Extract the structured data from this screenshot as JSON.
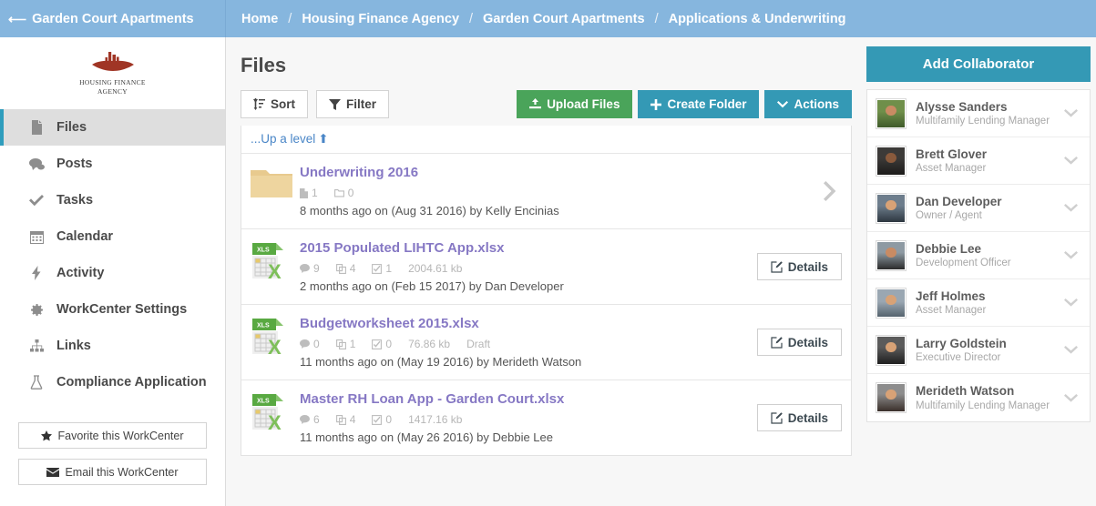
{
  "topbar": {
    "workcenter_name": "Garden Court Apartments",
    "back_icon": "arrow-left-icon",
    "breadcrumb": [
      "Home",
      "Housing Finance Agency",
      "Garden Court Apartments",
      "Applications & Underwriting"
    ],
    "breadcrumb_separator": "/",
    "bg_color": "#86b6de"
  },
  "sidebar": {
    "logo_line1": "HOUSING FINANCE",
    "logo_line2": "AGENCY",
    "logo_color": "#a03525",
    "items": [
      {
        "label": "Files",
        "icon": "file-icon",
        "active": true
      },
      {
        "label": "Posts",
        "icon": "comments-icon",
        "active": false
      },
      {
        "label": "Tasks",
        "icon": "check-icon",
        "active": false
      },
      {
        "label": "Calendar",
        "icon": "calendar-icon",
        "active": false
      },
      {
        "label": "Activity",
        "icon": "bolt-icon",
        "active": false
      },
      {
        "label": "WorkCenter Settings",
        "icon": "gear-icon",
        "active": false
      },
      {
        "label": "Links",
        "icon": "sitemap-icon",
        "active": false
      },
      {
        "label": "Compliance Application",
        "icon": "flask-icon",
        "active": false
      }
    ],
    "favorite_button": "Favorite this WorkCenter",
    "favorite_icon": "star-icon",
    "email_button": "Email this WorkCenter",
    "email_icon": "envelope-icon",
    "active_accent": "#2f9dbd"
  },
  "main": {
    "page_title": "Files",
    "toolbar": {
      "sort_label": "Sort",
      "sort_icon": "sort-amount-icon",
      "filter_label": "Filter",
      "filter_icon": "funnel-icon",
      "upload_label": "Upload Files",
      "upload_icon": "upload-icon",
      "create_folder_label": "Create Folder",
      "create_folder_icon": "plus-icon",
      "actions_label": "Actions",
      "actions_icon": "chevron-down-icon",
      "upload_color": "#4aa45a",
      "teal_color": "#3499b5"
    },
    "up_a_level": "...Up a level",
    "up_a_level_icon": "arrow-up-icon",
    "rows": [
      {
        "type": "folder",
        "icon": "folder-icon",
        "name": "Underwriting 2016",
        "meta": [
          {
            "icon": "file-icon",
            "value": "1"
          },
          {
            "icon": "folder-outline-icon",
            "value": "0"
          }
        ],
        "size": "",
        "status": "",
        "sub": "8 months ago on (Aug 31 2016) by Kelly Encinias",
        "action": "chevron-right-icon"
      },
      {
        "type": "file",
        "icon": "xls-icon",
        "name": "2015 Populated LIHTC App.xlsx",
        "meta": [
          {
            "icon": "comment-icon",
            "value": "9"
          },
          {
            "icon": "copy-icon",
            "value": "4"
          },
          {
            "icon": "check-square-icon",
            "value": "1"
          }
        ],
        "size": "2004.61 kb",
        "status": "",
        "sub": "2 months ago on (Feb 15 2017) by Dan Developer",
        "action": "Details",
        "action_icon": "pencil-square-icon"
      },
      {
        "type": "file",
        "icon": "xls-icon",
        "name": "Budgetworksheet 2015.xlsx",
        "meta": [
          {
            "icon": "comment-icon",
            "value": "0"
          },
          {
            "icon": "copy-icon",
            "value": "1"
          },
          {
            "icon": "check-square-icon",
            "value": "0"
          }
        ],
        "size": "76.86 kb",
        "status": "Draft",
        "sub": "11 months ago on (May 19 2016) by Merideth Watson",
        "action": "Details",
        "action_icon": "pencil-square-icon"
      },
      {
        "type": "file",
        "icon": "xls-icon",
        "name": "Master RH Loan App - Garden Court.xlsx",
        "meta": [
          {
            "icon": "comment-icon",
            "value": "6"
          },
          {
            "icon": "copy-icon",
            "value": "4"
          },
          {
            "icon": "check-square-icon",
            "value": "0"
          }
        ],
        "size": "1417.16 kb",
        "status": "",
        "sub": "11 months ago on (May 26 2016) by Debbie Lee",
        "action": "Details",
        "action_icon": "pencil-square-icon"
      }
    ]
  },
  "right_panel": {
    "add_collaborator": "Add Collaborator",
    "chevron_icon": "chevron-down-icon",
    "collaborators": [
      {
        "name": "Alysse Sanders",
        "role": "Multifamily Lending Manager",
        "avatar_top": "#6f8f4a",
        "avatar_bottom": "#3f5a2a",
        "skin": "#c98b63"
      },
      {
        "name": "Brett Glover",
        "role": "Asset Manager",
        "avatar_top": "#3c3a38",
        "avatar_bottom": "#1c1b1a",
        "skin": "#8a5a3c"
      },
      {
        "name": "Dan Developer",
        "role": "Owner / Agent",
        "avatar_top": "#6d7d8c",
        "avatar_bottom": "#2d3740",
        "skin": "#d8a276"
      },
      {
        "name": "Debbie Lee",
        "role": "Development Officer",
        "avatar_top": "#8e9aa3",
        "avatar_bottom": "#2b2b2b",
        "skin": "#c98b63"
      },
      {
        "name": "Jeff Holmes",
        "role": "Asset Manager",
        "avatar_top": "#9aa7b2",
        "avatar_bottom": "#55636e",
        "skin": "#d8a276"
      },
      {
        "name": "Larry Goldstein",
        "role": "Executive Director",
        "avatar_top": "#5b5b5b",
        "avatar_bottom": "#1f1f1f",
        "skin": "#d8a276"
      },
      {
        "name": "Merideth Watson",
        "role": "Multifamily Lending Manager",
        "avatar_top": "#8d8d8d",
        "avatar_bottom": "#3a2f2a",
        "skin": "#d8a276"
      }
    ]
  }
}
